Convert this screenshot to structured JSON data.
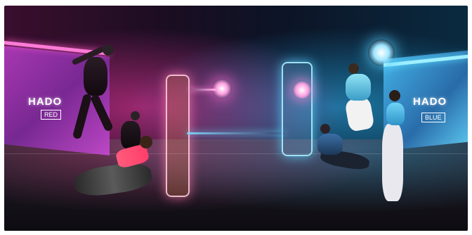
{
  "image": {
    "left_team_logo": "HADO",
    "left_team_name": "RED",
    "right_team_logo": "HADO",
    "right_team_name": "BLUE",
    "colors": {
      "red_team": "#ff3e9a",
      "blue_team": "#49c7ff",
      "background_dark": "#14101c"
    }
  }
}
